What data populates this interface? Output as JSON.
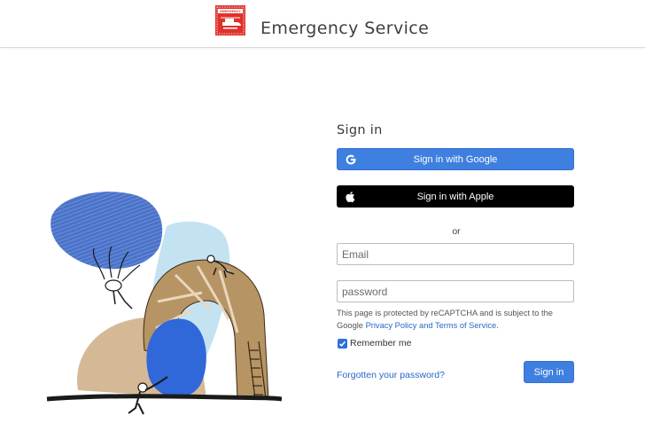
{
  "header": {
    "logo_icon": "emergency-helicopter-logo",
    "logo_text": "EMERGENCY",
    "app_title": "Emergency Service"
  },
  "illustration": {
    "icon": "abstract-people-with-arch-illustration"
  },
  "signin": {
    "heading": "Sign in",
    "google_label": "Sign in with Google",
    "google_icon": "google-g-icon",
    "apple_label": "Sign in with Apple",
    "apple_icon": "apple-icon",
    "or": "or",
    "email_placeholder": "Email",
    "password_placeholder": "password",
    "recaptcha_prefix": "This page is protected by reCAPTCHA and is subject to the Google ",
    "privacy_link": "Privacy Policy",
    "and_text": " and ",
    "terms_link": "Terms of Service",
    "recaptcha_suffix": ".",
    "remember_label": "Remember me",
    "remember_checked": true,
    "forgot_link": "Forgotten your password?",
    "submit_label": "Sign in"
  },
  "colors": {
    "primary": "#3f7fe0",
    "link": "#2b66c6",
    "apple_bg": "#000000",
    "logo_red": "#e0312b"
  }
}
